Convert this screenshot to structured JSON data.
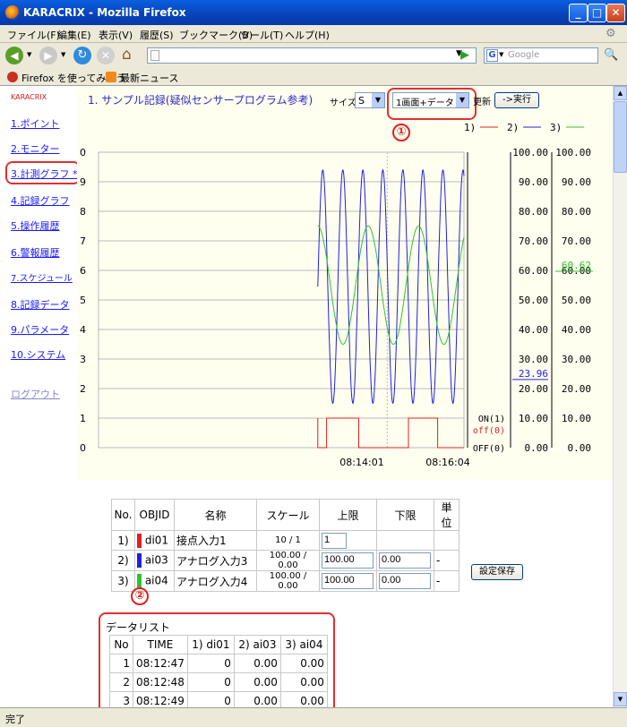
{
  "window": {
    "title": "KARACRIX - Mozilla Firefox"
  },
  "menu": [
    "ファイル(F)",
    "編集(E)",
    "表示(V)",
    "履歴(S)",
    "ブックマーク(B)",
    "ツール(T)",
    "ヘルプ(H)"
  ],
  "nav": {
    "search_placeholder": "Google"
  },
  "bookmarks": [
    "Firefox を使ってみよう",
    "最新ニュース"
  ],
  "status": "完了",
  "sidebar": {
    "logo": "KARACRIX",
    "items": [
      "1.ポイント",
      "2.モニター",
      "3.計測グラフ *",
      "4.記録グラフ",
      "5.操作履歴",
      "6.警報履歴",
      "7.スケジュール",
      "8.記録データ",
      "9.パラメータ",
      "10.システム"
    ],
    "logout": "ログアウト"
  },
  "header": {
    "title": "1. サンプル記録(疑似センサープログラム参考)",
    "size_label": "サイズ",
    "size_value": "S",
    "view_value": "1画面+データ",
    "update_label": "更新",
    "exec_label": "->実行"
  },
  "annotations": {
    "one": "①",
    "two": "②"
  },
  "chart_data": {
    "type": "line",
    "legend": [
      "1)",
      "2)",
      "3)"
    ],
    "series_colors": [
      "#e02020",
      "#2020e0",
      "#30c030"
    ],
    "left_ticks": [
      "0",
      "9",
      "8",
      "7",
      "6",
      "5",
      "4",
      "3",
      "2",
      "1",
      "0"
    ],
    "axis_onoff": [
      "ON(1)",
      "off(0)",
      "OFF(0)"
    ],
    "axis_pct_ticks": [
      "100.00",
      "90.00",
      "80.00",
      "70.00",
      "60.00",
      "50.00",
      "40.00",
      "30.00",
      "20.00",
      "10.00",
      "0.00"
    ],
    "x_labels": [
      "08:14:01",
      "08:16:04"
    ],
    "current_ai03": "23.96",
    "current_ai04": "60.62",
    "series": [
      {
        "name": "1) di01",
        "kind": "pulse",
        "high": 1,
        "low": 0,
        "pulses": [
          [
            0.06,
            0.28
          ],
          [
            0.62,
            0.82
          ]
        ]
      },
      {
        "name": "2) ai03",
        "kind": "sine",
        "min": 1.5,
        "max": 9.4,
        "periods": 7.3,
        "phase": 0
      },
      {
        "name": "3) ai04",
        "kind": "sine",
        "min": 3.5,
        "max": 7.5,
        "periods": 2.9,
        "phase": 1.57
      }
    ],
    "data_start_fraction": 0.6,
    "ylim": [
      0,
      10
    ]
  },
  "config_table": {
    "headers": [
      "No.",
      "OBJID",
      "名称",
      "スケール",
      "上限",
      "下限",
      "単位"
    ],
    "rows": [
      {
        "no": "1)",
        "objid": "di01",
        "name": "接点入力1",
        "scale": "10 / 1",
        "upper": "1",
        "lower": "",
        "unit": ""
      },
      {
        "no": "2)",
        "objid": "ai03",
        "name": "アナログ入力3",
        "scale": "100.00 / 0.00",
        "upper": "100.00",
        "lower": "0.00",
        "unit": "-"
      },
      {
        "no": "3)",
        "objid": "ai04",
        "name": "アナログ入力4",
        "scale": "100.00 / 0.00",
        "upper": "100.00",
        "lower": "0.00",
        "unit": "-"
      }
    ],
    "save_label": "設定保存"
  },
  "datalist": {
    "title": "データリスト",
    "headers": [
      "No",
      "TIME",
      "1) di01",
      "2) ai03",
      "3) ai04"
    ],
    "rows": [
      [
        "1",
        "08:12:47",
        "0",
        "0.00",
        "0.00"
      ],
      [
        "2",
        "08:12:48",
        "0",
        "0.00",
        "0.00"
      ],
      [
        "3",
        "08:12:49",
        "0",
        "0.00",
        "0.00"
      ]
    ]
  }
}
